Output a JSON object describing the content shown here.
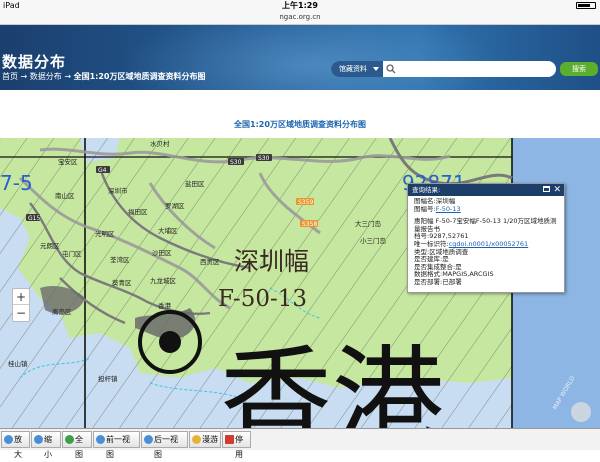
{
  "status": {
    "device": "iPad",
    "time": "上午1:29"
  },
  "url": "ngac.org.cn",
  "header": {
    "site_title": "数据分布",
    "breadcrumb": [
      "首页",
      " → ",
      "数据分布",
      " → ",
      "全国1:20万区域地质调查资料分布图"
    ],
    "search": {
      "select_label": "馆藏资料",
      "placeholder": "",
      "button": "搜索"
    }
  },
  "map_title": "全国1:20万区域地质调查资料分布图",
  "map": {
    "sheet_name": "深圳幅",
    "sheet_code": "F-50-13",
    "city_large": "香港",
    "edge_labels": {
      "left_number": "7‑5",
      "right_number": "92871"
    },
    "places": [
      "宝安区",
      "深圳市",
      "福田区",
      "罗湖区",
      "盐田区",
      "南山区",
      "光明区",
      "屯门区",
      "元朗区",
      "荃湾区",
      "大埔区",
      "沙田区",
      "葵青区",
      "九龙城区",
      "西贡区",
      "香港",
      "离岛区",
      "桂山镇",
      "担杆镇",
      "大三门岛",
      "小三门岛",
      "水贝村"
    ],
    "roads": [
      "G4",
      "G15",
      "S30",
      "S30",
      "S359",
      "S358"
    ],
    "zoom": {
      "in": "+",
      "out": "−"
    },
    "colors": {
      "land": "#c6e79f",
      "sea": "#c8dcf2",
      "right_sheet": "#8db6e5",
      "hatch": "#556655",
      "road": "#6a6a6a"
    }
  },
  "popup": {
    "title": "查询结果:",
    "lines": [
      {
        "label": "图幅名:",
        "value": "深圳幅"
      },
      {
        "label": "图幅号:",
        "value": "F-50-13",
        "link": true
      },
      {
        "label": "",
        "value": ""
      },
      {
        "label": "",
        "value": "惠阳幅 F-50-7宝安幅F-50-13 1/20万区域地质测量报告书"
      },
      {
        "label": "档号:",
        "value": "9287,52761"
      },
      {
        "label": "唯一标识符:",
        "value": "cgdoi.n0001/x00052761",
        "link": true
      },
      {
        "label": "类型:",
        "value": "区域地质调查"
      },
      {
        "label": "是否建库:",
        "value": "是"
      },
      {
        "label": "是否集成整合:",
        "value": "是"
      },
      {
        "label": "数据格式:",
        "value": "MAPGIS,ARCGIS"
      },
      {
        "label": "是否部署:",
        "value": "已部署"
      }
    ]
  },
  "toolbar": [
    {
      "label": "放大",
      "icon": "zoom-in-icon"
    },
    {
      "label": "缩小",
      "icon": "zoom-out-icon"
    },
    {
      "label": "全图",
      "icon": "globe-icon"
    },
    {
      "label": "前一视图",
      "icon": "back-view-icon"
    },
    {
      "label": "后一视图",
      "icon": "forward-view-icon"
    },
    {
      "label": "漫游",
      "icon": "pan-icon"
    },
    {
      "label": "停用",
      "icon": "stop-icon"
    }
  ],
  "watermark": "MAP WORLD"
}
